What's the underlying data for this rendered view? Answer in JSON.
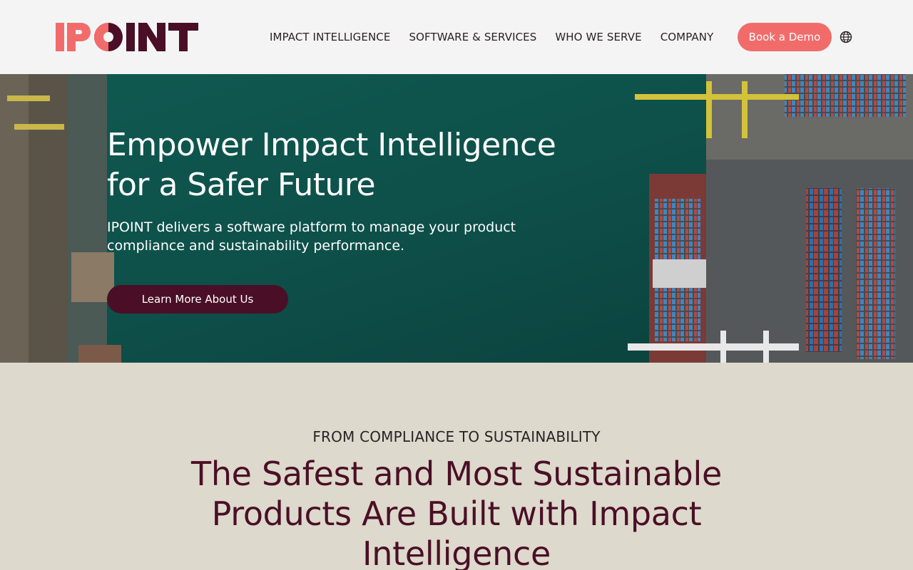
{
  "brand": {
    "logo_text": "IPOINT",
    "colors": {
      "coral": "#f26b6b",
      "maroon": "#4a0f26",
      "teal": "#0f4a45",
      "sand": "#ddd9cc"
    }
  },
  "nav": {
    "items": [
      {
        "label": "IMPACT INTELLIGENCE"
      },
      {
        "label": "SOFTWARE & SERVICES"
      },
      {
        "label": "WHO WE SERVE"
      },
      {
        "label": "COMPANY"
      }
    ],
    "cta_label": "Book a Demo",
    "language_icon": "globe-icon"
  },
  "hero": {
    "title_line1": "Empower Impact Intelligence",
    "title_line2": "for a Safer Future",
    "subtitle": "IPOINT delivers a software platform to manage your product compliance and sustainability performance.",
    "button_label": "Learn More About Us"
  },
  "section": {
    "eyebrow": "FROM COMPLIANCE TO SUSTAINABILITY",
    "title": "The Safest and Most Sustainable Products Are Built with Impact Intelligence"
  }
}
